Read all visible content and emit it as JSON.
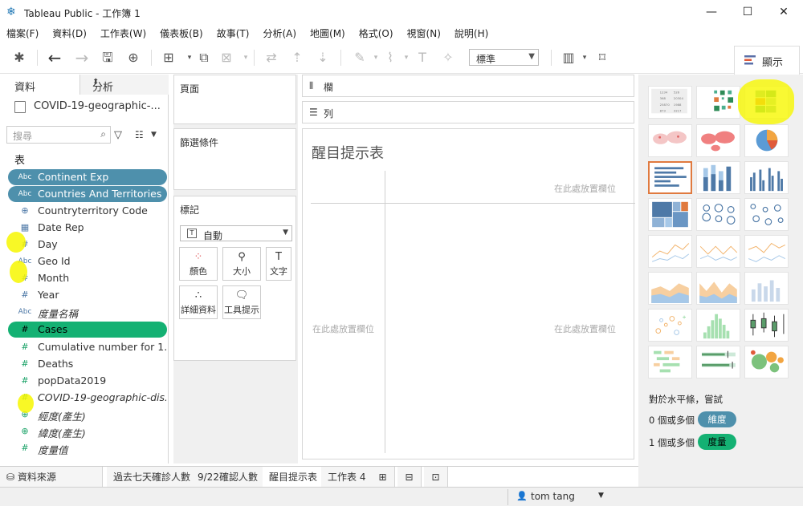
{
  "window": {
    "title": "Tableau Public - 工作簿 1",
    "minimize": "—",
    "maximize": "☐",
    "close": "✕"
  },
  "menubar": [
    "檔案(F)",
    "資料(D)",
    "工作表(W)",
    "儀表板(B)",
    "故事(T)",
    "分析(A)",
    "地圖(M)",
    "格式(O)",
    "視窗(N)",
    "說明(H)"
  ],
  "toolbar": {
    "fit_select": "標準"
  },
  "show_me_tab": {
    "label": "顯示"
  },
  "data_pane": {
    "tabs": {
      "data": "資料",
      "analytics": "分析"
    },
    "datasource": "COVID-19-geographic-...",
    "search_placeholder": "搜尋",
    "tables_header": "表",
    "fields": [
      {
        "type": "Abc",
        "name": "Continent Exp",
        "kind": "dim",
        "highlight": true
      },
      {
        "type": "Abc",
        "name": "Countries And Territories",
        "kind": "dim",
        "highlight": true
      },
      {
        "type": "globe",
        "name": "Countryterritory Code",
        "kind": "dim"
      },
      {
        "type": "date",
        "name": "Date Rep",
        "kind": "dim"
      },
      {
        "type": "#",
        "name": "Day",
        "kind": "dim"
      },
      {
        "type": "Abc",
        "name": "Geo Id",
        "kind": "dim"
      },
      {
        "type": "#",
        "name": "Month",
        "kind": "dim"
      },
      {
        "type": "#",
        "name": "Year",
        "kind": "dim"
      },
      {
        "type": "Abc",
        "name": "度量名稱",
        "kind": "dim",
        "italic": true
      },
      {
        "type": "#",
        "name": "Cases",
        "kind": "mea",
        "highlight": true
      },
      {
        "type": "#",
        "name": "Cumulative number for 1...",
        "kind": "mea"
      },
      {
        "type": "#",
        "name": "Deaths",
        "kind": "mea"
      },
      {
        "type": "#",
        "name": "popData2019",
        "kind": "mea"
      },
      {
        "type": "#",
        "name": "COVID-19-geographic-dis...",
        "kind": "mea",
        "italic": true
      },
      {
        "type": "globe",
        "name": "經度(產生)",
        "kind": "mea",
        "italic": true
      },
      {
        "type": "globe",
        "name": "緯度(產生)",
        "kind": "mea",
        "italic": true
      },
      {
        "type": "#",
        "name": "度量值",
        "kind": "mea",
        "italic": true
      }
    ]
  },
  "cards": {
    "pages": "頁面",
    "filters": "篩選條件",
    "marks": "標記",
    "mark_type": "自動",
    "mark_buttons": [
      "顏色",
      "大小",
      "文字",
      "詳細資料",
      "工具提示"
    ]
  },
  "shelves": {
    "columns": "欄",
    "rows": "列"
  },
  "view": {
    "title": "醒目提示表",
    "drop_top": "在此處放置欄位",
    "drop_left": "在此處放置欄位",
    "drop_center": "在此處放置欄位"
  },
  "show_me": {
    "hint_title": "對於水平條，嘗試",
    "hint_dim_prefix": "0 個或多個",
    "hint_dim": "維度",
    "hint_mea_prefix": "1 個或多個",
    "hint_mea": "度量",
    "thumb_table_text": [
      "1234",
      "526",
      "368",
      "20304",
      "25870",
      "1988",
      "873",
      "3217"
    ]
  },
  "bottom_tabs": [
    "資料來源",
    "過去七天確診人數",
    "9/22確認人數",
    "醒目提示表",
    "工作表 4"
  ],
  "status": {
    "user": "tom tang"
  },
  "colors": {
    "dimension": "#4e90ac",
    "measure": "#14b173",
    "highlight": "#f7f700",
    "selected_chart": "#e07a3f"
  }
}
